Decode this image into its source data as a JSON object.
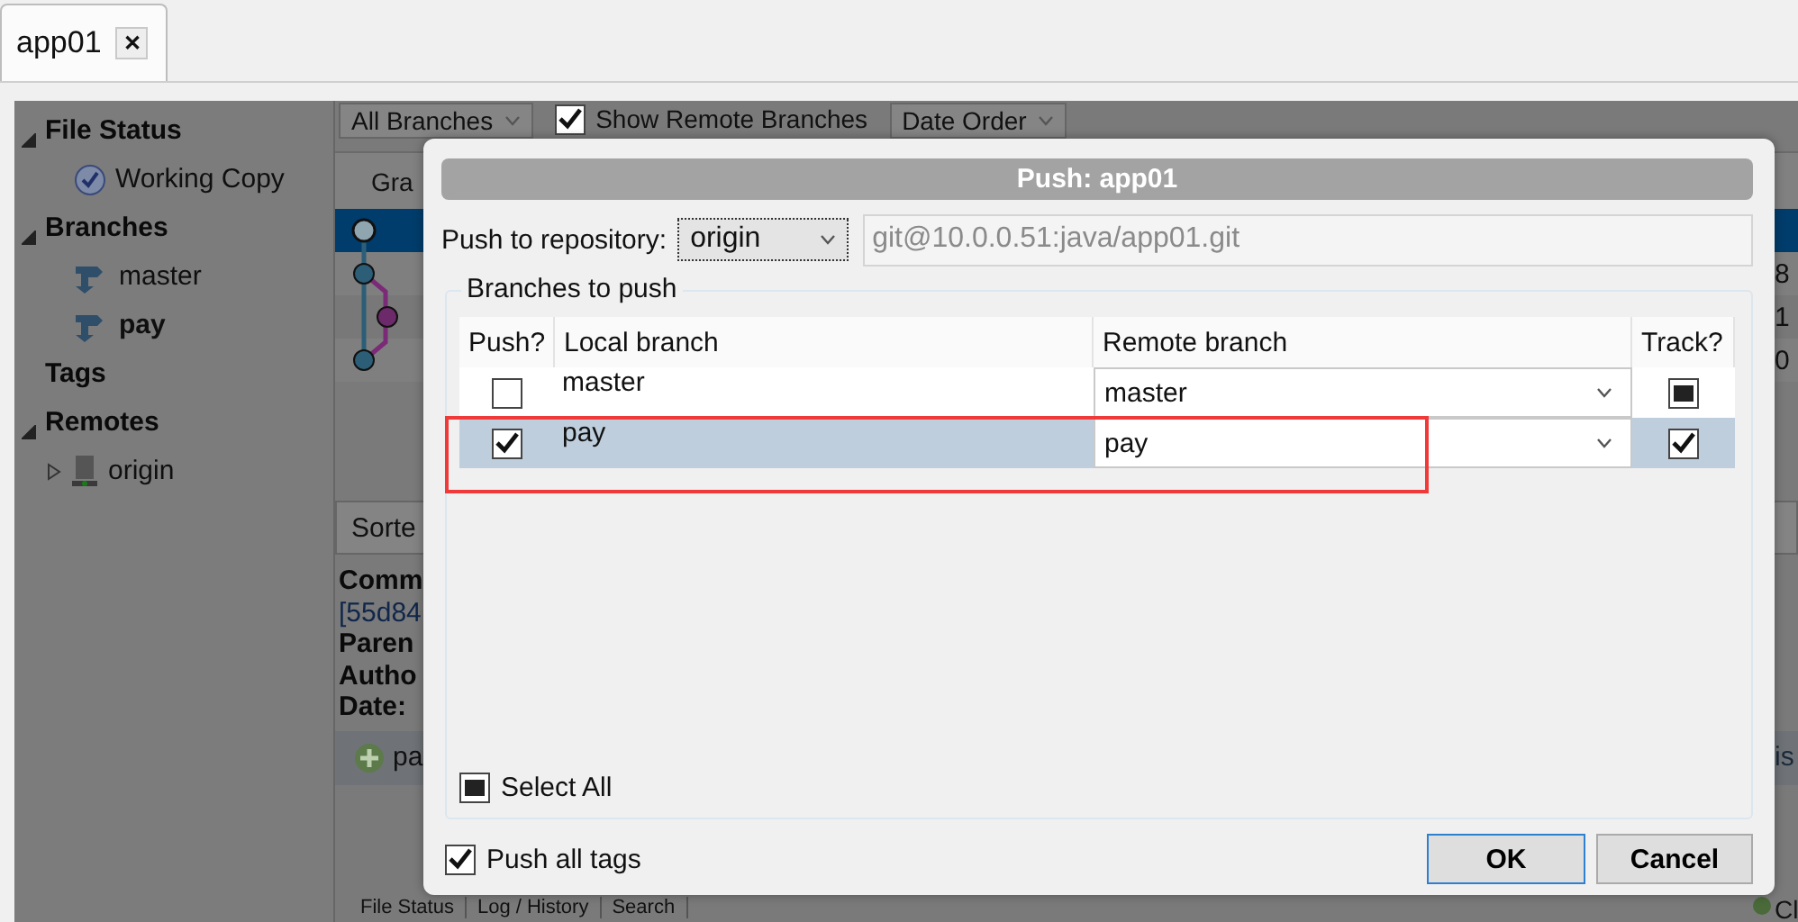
{
  "tabs": [
    {
      "label": "app01",
      "close": "✕",
      "selected": true
    }
  ],
  "sidebar": {
    "sections": [
      {
        "title": "File Status",
        "expanded": true,
        "children": [
          {
            "label": "Working Copy",
            "kind": "workingcopy",
            "current": false
          }
        ]
      },
      {
        "title": "Branches",
        "expanded": true,
        "children": [
          {
            "label": "master",
            "kind": "branch",
            "current": false
          },
          {
            "label": "pay",
            "kind": "branch",
            "current": true
          }
        ]
      },
      {
        "title": "Tags"
      },
      {
        "title": "Remotes",
        "expanded": true,
        "children": [
          {
            "label": "origin",
            "kind": "remote",
            "current": false,
            "expanded": false
          }
        ]
      }
    ]
  },
  "toolbar": {
    "branch_filter": "All Branches",
    "show_remote": {
      "label": "Show Remote Branches",
      "checked": true
    },
    "order": "Date Order"
  },
  "graph": {
    "header": "Gra",
    "rows": [
      {
        "selected": true,
        "column_3": ""
      },
      {
        "selected": false,
        "column_3": "8"
      },
      {
        "selected": false,
        "column_3": "1"
      },
      {
        "selected": false,
        "column_3": "0"
      }
    ]
  },
  "details": {
    "sort_label": "Sorte",
    "lines": [
      {
        "text": "Comm",
        "bold": true
      },
      {
        "text": "[55d84",
        "bold": false
      },
      {
        "text": "Paren",
        "bold": true
      },
      {
        "text": "Autho",
        "bold": true
      },
      {
        "text": "Date:",
        "bold": true
      }
    ],
    "side_fragment": "is",
    "file": "pa"
  },
  "bottom_tabs": [
    "File Status",
    "Log / History",
    "Search"
  ],
  "status_fragment": "Cl",
  "dialog": {
    "title": "Push: app01",
    "repository_label": "Push to repository:",
    "repository": "origin",
    "url": "git@10.0.0.51:java/app01.git",
    "group_title": "Branches to push",
    "columns": [
      "Push?",
      "Local branch",
      "Remote branch",
      "Track?"
    ],
    "rows": [
      {
        "push": {
          "checked": false,
          "mixed": false
        },
        "local": "master",
        "remote": "master",
        "track": {
          "checked": false,
          "mixed": true
        },
        "selected": false
      },
      {
        "push": {
          "checked": true,
          "mixed": false
        },
        "local": "pay",
        "remote": "pay",
        "track": {
          "checked": true,
          "mixed": false
        },
        "selected": true
      }
    ],
    "select_all": {
      "label": "Select All",
      "checked": false,
      "mixed": true
    },
    "push_tags": {
      "label": "Push all tags",
      "checked": true,
      "mixed": false
    },
    "buttons": [
      {
        "label": "OK",
        "default": true
      },
      {
        "label": "Cancel",
        "default": false
      }
    ]
  }
}
